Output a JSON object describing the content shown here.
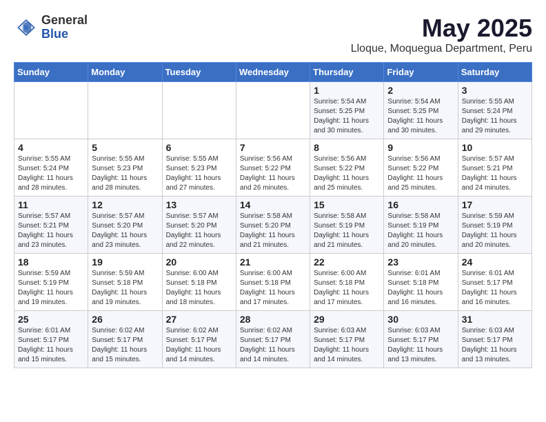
{
  "logo": {
    "general": "General",
    "blue": "Blue"
  },
  "header": {
    "month": "May 2025",
    "location": "Lloque, Moquegua Department, Peru"
  },
  "weekdays": [
    "Sunday",
    "Monday",
    "Tuesday",
    "Wednesday",
    "Thursday",
    "Friday",
    "Saturday"
  ],
  "weeks": [
    [
      {
        "day": "",
        "info": ""
      },
      {
        "day": "",
        "info": ""
      },
      {
        "day": "",
        "info": ""
      },
      {
        "day": "",
        "info": ""
      },
      {
        "day": "1",
        "info": "Sunrise: 5:54 AM\nSunset: 5:25 PM\nDaylight: 11 hours\nand 30 minutes."
      },
      {
        "day": "2",
        "info": "Sunrise: 5:54 AM\nSunset: 5:25 PM\nDaylight: 11 hours\nand 30 minutes."
      },
      {
        "day": "3",
        "info": "Sunrise: 5:55 AM\nSunset: 5:24 PM\nDaylight: 11 hours\nand 29 minutes."
      }
    ],
    [
      {
        "day": "4",
        "info": "Sunrise: 5:55 AM\nSunset: 5:24 PM\nDaylight: 11 hours\nand 28 minutes."
      },
      {
        "day": "5",
        "info": "Sunrise: 5:55 AM\nSunset: 5:23 PM\nDaylight: 11 hours\nand 28 minutes."
      },
      {
        "day": "6",
        "info": "Sunrise: 5:55 AM\nSunset: 5:23 PM\nDaylight: 11 hours\nand 27 minutes."
      },
      {
        "day": "7",
        "info": "Sunrise: 5:56 AM\nSunset: 5:22 PM\nDaylight: 11 hours\nand 26 minutes."
      },
      {
        "day": "8",
        "info": "Sunrise: 5:56 AM\nSunset: 5:22 PM\nDaylight: 11 hours\nand 25 minutes."
      },
      {
        "day": "9",
        "info": "Sunrise: 5:56 AM\nSunset: 5:22 PM\nDaylight: 11 hours\nand 25 minutes."
      },
      {
        "day": "10",
        "info": "Sunrise: 5:57 AM\nSunset: 5:21 PM\nDaylight: 11 hours\nand 24 minutes."
      }
    ],
    [
      {
        "day": "11",
        "info": "Sunrise: 5:57 AM\nSunset: 5:21 PM\nDaylight: 11 hours\nand 23 minutes."
      },
      {
        "day": "12",
        "info": "Sunrise: 5:57 AM\nSunset: 5:20 PM\nDaylight: 11 hours\nand 23 minutes."
      },
      {
        "day": "13",
        "info": "Sunrise: 5:57 AM\nSunset: 5:20 PM\nDaylight: 11 hours\nand 22 minutes."
      },
      {
        "day": "14",
        "info": "Sunrise: 5:58 AM\nSunset: 5:20 PM\nDaylight: 11 hours\nand 21 minutes."
      },
      {
        "day": "15",
        "info": "Sunrise: 5:58 AM\nSunset: 5:19 PM\nDaylight: 11 hours\nand 21 minutes."
      },
      {
        "day": "16",
        "info": "Sunrise: 5:58 AM\nSunset: 5:19 PM\nDaylight: 11 hours\nand 20 minutes."
      },
      {
        "day": "17",
        "info": "Sunrise: 5:59 AM\nSunset: 5:19 PM\nDaylight: 11 hours\nand 20 minutes."
      }
    ],
    [
      {
        "day": "18",
        "info": "Sunrise: 5:59 AM\nSunset: 5:19 PM\nDaylight: 11 hours\nand 19 minutes."
      },
      {
        "day": "19",
        "info": "Sunrise: 5:59 AM\nSunset: 5:18 PM\nDaylight: 11 hours\nand 19 minutes."
      },
      {
        "day": "20",
        "info": "Sunrise: 6:00 AM\nSunset: 5:18 PM\nDaylight: 11 hours\nand 18 minutes."
      },
      {
        "day": "21",
        "info": "Sunrise: 6:00 AM\nSunset: 5:18 PM\nDaylight: 11 hours\nand 17 minutes."
      },
      {
        "day": "22",
        "info": "Sunrise: 6:00 AM\nSunset: 5:18 PM\nDaylight: 11 hours\nand 17 minutes."
      },
      {
        "day": "23",
        "info": "Sunrise: 6:01 AM\nSunset: 5:18 PM\nDaylight: 11 hours\nand 16 minutes."
      },
      {
        "day": "24",
        "info": "Sunrise: 6:01 AM\nSunset: 5:17 PM\nDaylight: 11 hours\nand 16 minutes."
      }
    ],
    [
      {
        "day": "25",
        "info": "Sunrise: 6:01 AM\nSunset: 5:17 PM\nDaylight: 11 hours\nand 15 minutes."
      },
      {
        "day": "26",
        "info": "Sunrise: 6:02 AM\nSunset: 5:17 PM\nDaylight: 11 hours\nand 15 minutes."
      },
      {
        "day": "27",
        "info": "Sunrise: 6:02 AM\nSunset: 5:17 PM\nDaylight: 11 hours\nand 14 minutes."
      },
      {
        "day": "28",
        "info": "Sunrise: 6:02 AM\nSunset: 5:17 PM\nDaylight: 11 hours\nand 14 minutes."
      },
      {
        "day": "29",
        "info": "Sunrise: 6:03 AM\nSunset: 5:17 PM\nDaylight: 11 hours\nand 14 minutes."
      },
      {
        "day": "30",
        "info": "Sunrise: 6:03 AM\nSunset: 5:17 PM\nDaylight: 11 hours\nand 13 minutes."
      },
      {
        "day": "31",
        "info": "Sunrise: 6:03 AM\nSunset: 5:17 PM\nDaylight: 11 hours\nand 13 minutes."
      }
    ]
  ]
}
